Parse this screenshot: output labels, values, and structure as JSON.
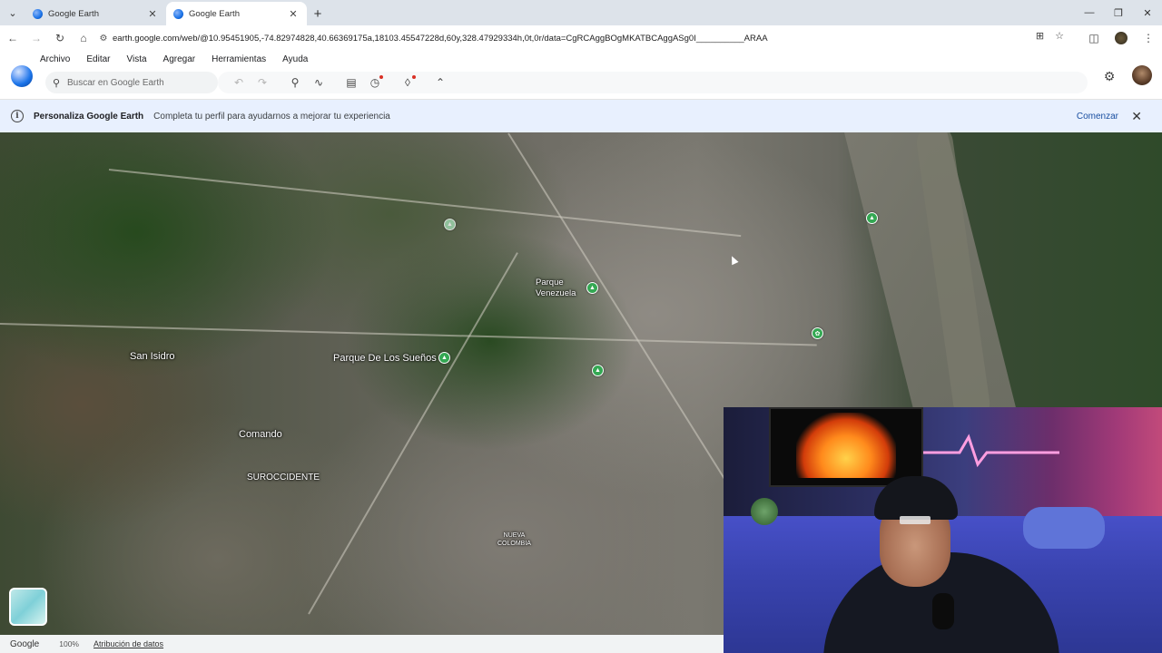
{
  "browser": {
    "tabs": [
      {
        "title": "Google Earth",
        "active": false
      },
      {
        "title": "Google Earth",
        "active": true
      }
    ],
    "url": "earth.google.com/web/@10.95451905,-74.82974828,40.66369175a,18103.45547228d,60y,328.47929334h,0t,0r/data=CgRCAggBOgMKATBCAggASg0I__________ARAA"
  },
  "app": {
    "menu": [
      "Archivo",
      "Editar",
      "Vista",
      "Agregar",
      "Herramientas",
      "Ayuda"
    ],
    "search": {
      "placeholder": "Buscar en Google Earth"
    },
    "accent": "#1a73e8"
  },
  "banner": {
    "title": "Personaliza Google Earth",
    "text": "Completa tu perfil para ayudarnos a mejorar tu experiencia",
    "action": "Comenzar"
  },
  "map": {
    "labels": {
      "parque_venezuela": "Parque\nVenezuela",
      "san_isidro": "San Isidro",
      "parque_suenos": "Parque De Los Sueños",
      "comando": "Comando",
      "suroccidente": "SUROCCIDENTE",
      "nueva_colombia": "NUEVA\nCOLOMBIA"
    },
    "pin_color": "#34a853"
  },
  "status": {
    "brand": "Google",
    "zoom": "100%",
    "attribution": "Atribución de datos"
  }
}
